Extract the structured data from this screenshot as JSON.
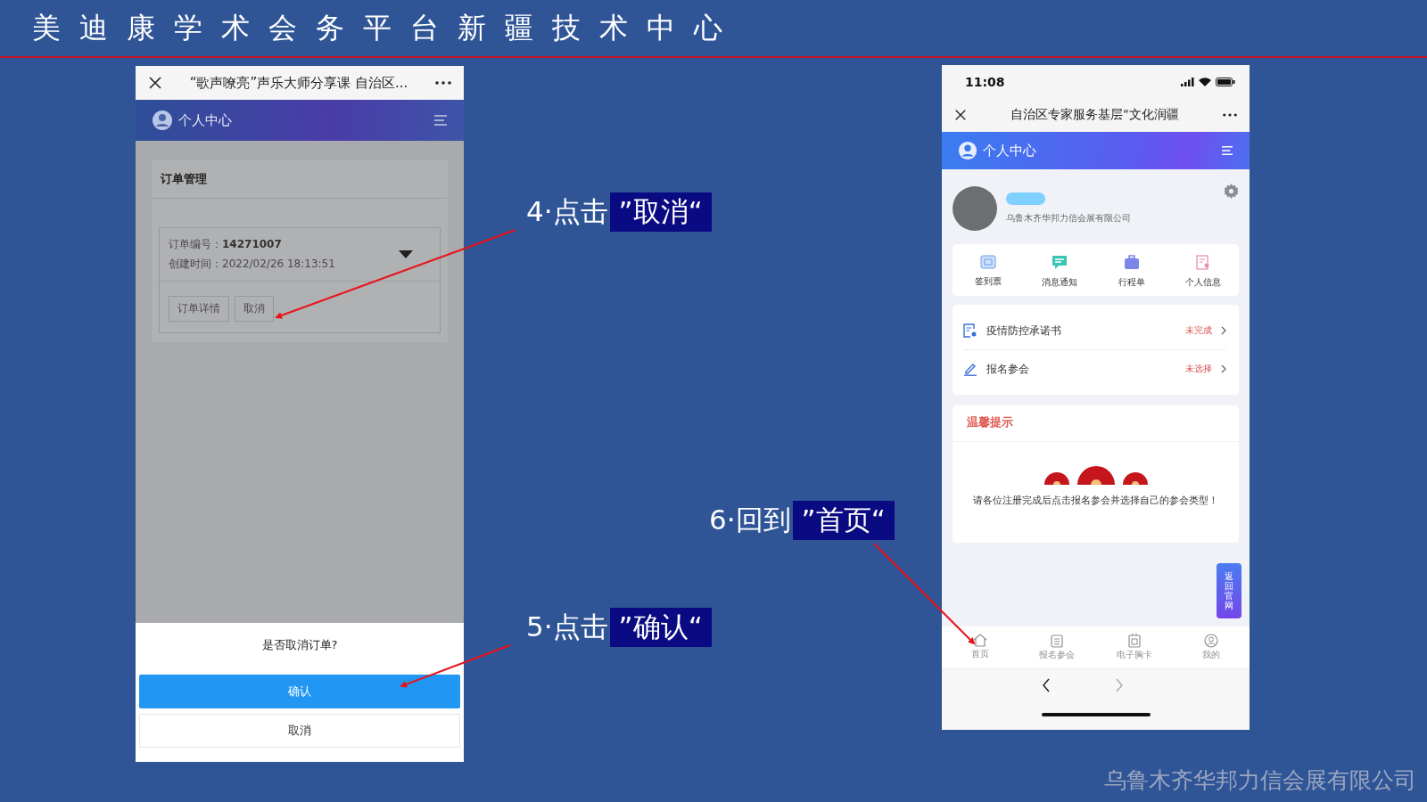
{
  "slide": {
    "title": "美迪康学术会务平台新疆技术中心",
    "company": "乌鲁木齐华邦力信会展有限公司"
  },
  "callouts": [
    {
      "step": "4·点击",
      "highlight": "”取消“"
    },
    {
      "step": "5·点击",
      "highlight": "”确认“"
    },
    {
      "step": "6·回到",
      "highlight": "”首页“"
    }
  ],
  "left_phone": {
    "title": "“歌声嘹亮”声乐大师分享课 自治区...",
    "header": "个人中心",
    "section": "订单管理",
    "order_number_label": "订单编号：",
    "order_number": "14271007",
    "created_label": "创建时间：",
    "created": "2022/02/26 18:13:51",
    "buttons": [
      "订单详情",
      "取消"
    ],
    "dialog": {
      "question": "是否取消订单?",
      "confirm": "确认",
      "cancel": "取消"
    }
  },
  "right_phone": {
    "time": "11:08",
    "title": "自治区专家服务基层“文化润疆",
    "header": "个人中心",
    "company": "乌鲁木齐华邦力信会展有限公司",
    "shortcuts": [
      {
        "label": "签到票",
        "kind": "ticket"
      },
      {
        "label": "消息通知",
        "kind": "message"
      },
      {
        "label": "行程单",
        "kind": "luggage"
      },
      {
        "label": "个人信息",
        "kind": "profile"
      }
    ],
    "tasks": [
      {
        "label": "疫情防控承诺书",
        "status": "未完成",
        "kind": "document"
      },
      {
        "label": "报名参会",
        "status": "未选择",
        "kind": "pen"
      }
    ],
    "notice": {
      "title": "温馨提示",
      "text": "请各位注册完成后点击报名参会并选择自己的参会类型！"
    },
    "float_button": "返回官网",
    "tabs": [
      {
        "label": "首页",
        "kind": "home",
        "selected": false
      },
      {
        "label": "报名参会",
        "kind": "clipboard",
        "selected": false
      },
      {
        "label": "电子胸卡",
        "kind": "badge",
        "selected": false
      },
      {
        "label": "我的",
        "kind": "user",
        "selected": false
      }
    ]
  }
}
